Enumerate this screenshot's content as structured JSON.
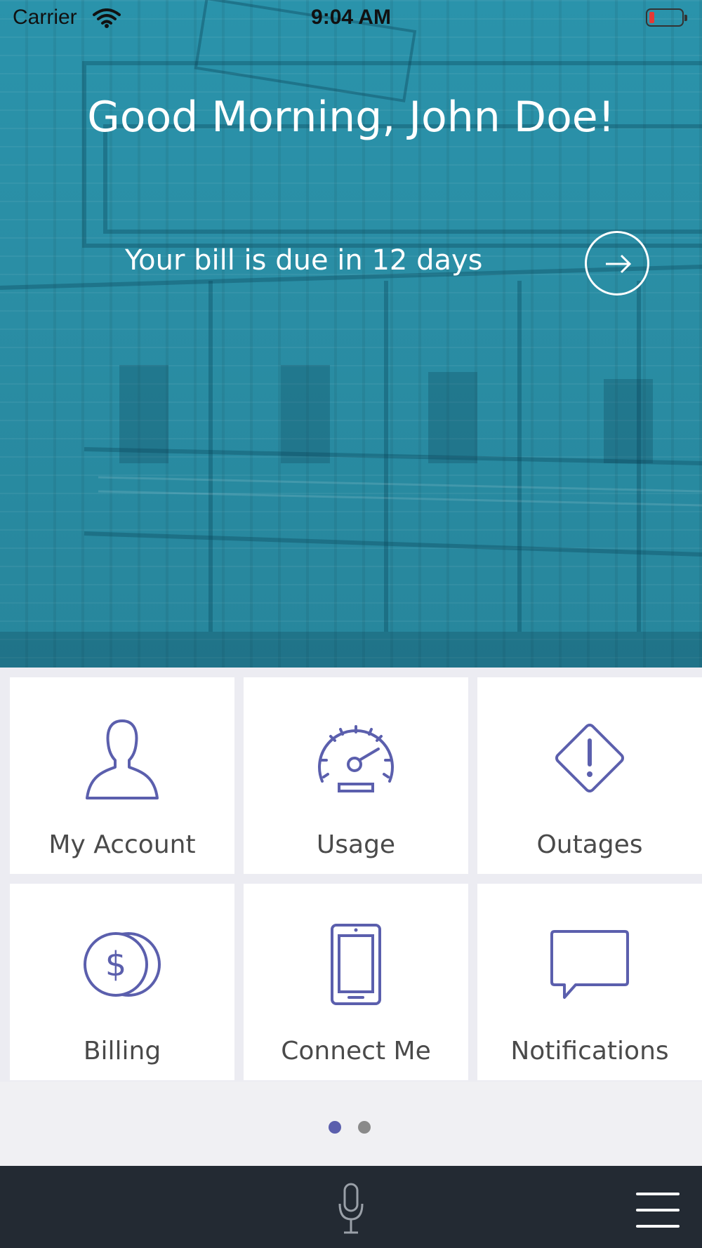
{
  "status_bar": {
    "carrier": "Carrier",
    "time": "9:04 AM",
    "battery_color": "#e53935"
  },
  "hero": {
    "greeting": "Good Morning, John Doe!",
    "bill_message": "Your bill is due in 12 days",
    "arrow_icon": "arrow-right-icon",
    "tint_color": "#2a8ea5"
  },
  "tiles": [
    {
      "label": "My Account",
      "icon": "person-icon"
    },
    {
      "label": "Usage",
      "icon": "speedometer-icon"
    },
    {
      "label": "Outages",
      "icon": "warning-diamond-icon"
    },
    {
      "label": "Billing",
      "icon": "dollar-coins-icon"
    },
    {
      "label": "Connect Me",
      "icon": "mobile-phone-icon"
    },
    {
      "label": "Notifications",
      "icon": "chat-bubble-icon"
    }
  ],
  "pager": {
    "pages": 2,
    "current": 1,
    "active_color": "#5b5fad",
    "inactive_color": "#8a8a8a"
  },
  "bottom_bar": {
    "mic_icon": "microphone-icon",
    "menu_icon": "hamburger-menu-icon"
  },
  "accent_color": "#5b5fad"
}
